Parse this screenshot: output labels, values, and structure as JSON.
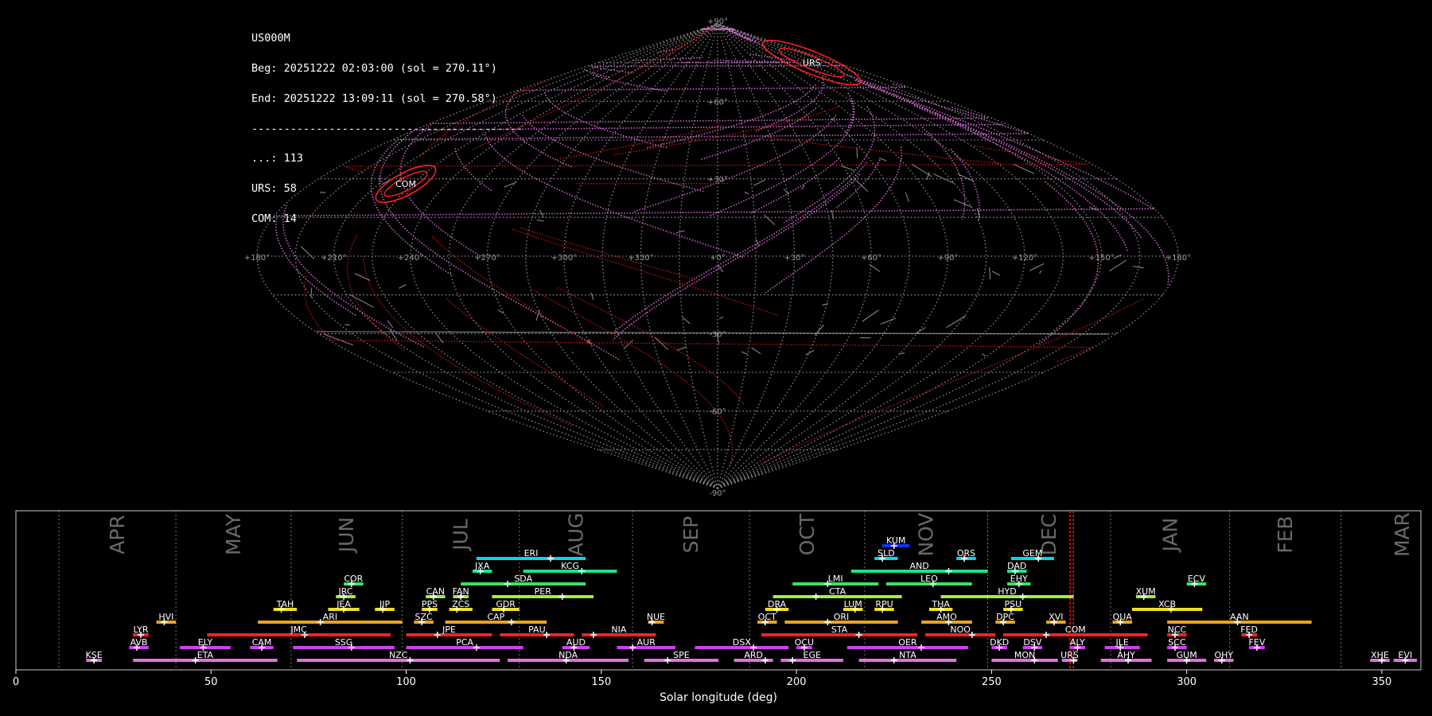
{
  "info": {
    "station": "US000M",
    "beg": "Beg: 20251222 02:03:00 (sol = 270.11°)",
    "end": "End: 20251222 13:09:11 (sol = 270.58°)",
    "separator": "------------------------------------------",
    "counts": [
      {
        "label": "...",
        "count": 113
      },
      {
        "label": "URS",
        "count": 58
      },
      {
        "label": "COM",
        "count": 14
      }
    ]
  },
  "sky_map": {
    "projection": "sinusoidal",
    "lon_labels": [
      "+180°",
      "+150°",
      "+120°",
      "+90°",
      "+60°",
      "+30°",
      "+0°",
      "+330°",
      "+300°",
      "+270°",
      "+240°",
      "+210°",
      "+180°"
    ],
    "lat_labels": [
      "+90°",
      "+60°",
      "+30°",
      "-30°",
      "-60°",
      "-90°"
    ],
    "radiants": [
      {
        "code": "URS",
        "lon_deg": 218,
        "lat_deg": 75,
        "color": "#ff2020"
      },
      {
        "code": "COM",
        "lon_deg": 138,
        "lat_deg": 28,
        "color": "#ff2020"
      }
    ],
    "track_color": "#e070e0",
    "sporadic_color": "#b0b0b0"
  },
  "chart_data": {
    "type": "timeline",
    "xlabel": "Solar longitude (deg)",
    "xlim": [
      0,
      360
    ],
    "xticks": [
      0,
      50,
      100,
      150,
      200,
      250,
      300,
      350
    ],
    "current_sol": [
      270.11,
      270.58
    ],
    "months": [
      {
        "name": "APR",
        "start": 11,
        "end": 41
      },
      {
        "name": "MAY",
        "start": 41,
        "end": 70.5
      },
      {
        "name": "JUN",
        "start": 70.5,
        "end": 99
      },
      {
        "name": "JUL",
        "start": 99,
        "end": 129
      },
      {
        "name": "AUG",
        "start": 129,
        "end": 158
      },
      {
        "name": "SEP",
        "start": 158,
        "end": 188
      },
      {
        "name": "OCT",
        "start": 188,
        "end": 217.5
      },
      {
        "name": "NOV",
        "start": 217.5,
        "end": 249
      },
      {
        "name": "DEC",
        "start": 249,
        "end": 280.5
      },
      {
        "name": "JAN",
        "start": 280.5,
        "end": 311
      },
      {
        "name": "FEB",
        "start": 311,
        "end": 339.5
      },
      {
        "name": "MAR",
        "start": 339.5,
        "end": 371
      }
    ],
    "showers": [
      {
        "code": "KUM",
        "row": 0,
        "start": 222,
        "end": 229,
        "peak": 225,
        "color": "#1a2eff"
      },
      {
        "code": "ERI",
        "row": 1,
        "start": 118,
        "end": 146,
        "peak": 137,
        "color": "#00d8f0"
      },
      {
        "code": "SLD",
        "row": 1,
        "start": 220,
        "end": 226,
        "peak": 222,
        "color": "#00d8f0"
      },
      {
        "code": "ORS",
        "row": 1,
        "start": 241,
        "end": 246,
        "peak": 243,
        "color": "#00d8f0"
      },
      {
        "code": "GEM",
        "row": 1,
        "start": 255,
        "end": 266,
        "peak": 262,
        "color": "#00d8f0"
      },
      {
        "code": "JXA",
        "row": 2,
        "start": 117,
        "end": 122,
        "peak": 119,
        "color": "#20e090"
      },
      {
        "code": "KCG",
        "row": 2,
        "start": 130,
        "end": 154,
        "peak": 145,
        "color": "#20e090"
      },
      {
        "code": "AND",
        "row": 2,
        "start": 214,
        "end": 249,
        "peak": 239,
        "color": "#20e090"
      },
      {
        "code": "DAD",
        "row": 2,
        "start": 254,
        "end": 259,
        "peak": 256,
        "color": "#20e090"
      },
      {
        "code": "COR",
        "row": 3,
        "start": 84,
        "end": 89,
        "peak": 86,
        "color": "#40e060"
      },
      {
        "code": "SDA",
        "row": 3,
        "start": 114,
        "end": 146,
        "peak": 126,
        "color": "#40e060"
      },
      {
        "code": "LMI",
        "row": 3,
        "start": 199,
        "end": 221,
        "peak": 208,
        "color": "#40e060"
      },
      {
        "code": "LEO",
        "row": 3,
        "start": 223,
        "end": 245,
        "peak": 235,
        "color": "#40e060"
      },
      {
        "code": "EHY",
        "row": 3,
        "start": 254,
        "end": 260,
        "peak": 257,
        "color": "#40e060"
      },
      {
        "code": "ECV",
        "row": 3,
        "start": 300,
        "end": 305,
        "peak": 302,
        "color": "#40e060"
      },
      {
        "code": "JRC",
        "row": 4,
        "start": 82,
        "end": 87,
        "peak": 84,
        "color": "#a0f040"
      },
      {
        "code": "CAN",
        "row": 4,
        "start": 105,
        "end": 110,
        "peak": 107,
        "color": "#a0f040"
      },
      {
        "code": "FAN",
        "row": 4,
        "start": 112,
        "end": 116,
        "peak": 114,
        "color": "#a0f040"
      },
      {
        "code": "PER",
        "row": 4,
        "start": 122,
        "end": 148,
        "peak": 140,
        "color": "#a0f040"
      },
      {
        "code": "CTA",
        "row": 4,
        "start": 194,
        "end": 227,
        "peak": 205,
        "color": "#a0f040"
      },
      {
        "code": "HYD",
        "row": 4,
        "start": 237,
        "end": 271,
        "peak": 258,
        "color": "#a0f040"
      },
      {
        "code": "XUM",
        "row": 4,
        "start": 287,
        "end": 292,
        "peak": 289,
        "color": "#a0f040"
      },
      {
        "code": "TAH",
        "row": 5,
        "start": 66,
        "end": 72,
        "peak": 68,
        "color": "#f0e020"
      },
      {
        "code": "JEA",
        "row": 5,
        "start": 80,
        "end": 88,
        "peak": 84,
        "color": "#f0e020"
      },
      {
        "code": "JIP",
        "row": 5,
        "start": 92,
        "end": 97,
        "peak": 94,
        "color": "#f0e020"
      },
      {
        "code": "PPS",
        "row": 5,
        "start": 104,
        "end": 108,
        "peak": 106,
        "color": "#f0e020"
      },
      {
        "code": "ZCS",
        "row": 5,
        "start": 111,
        "end": 117,
        "peak": 113,
        "color": "#f0e020"
      },
      {
        "code": "GDR",
        "row": 5,
        "start": 122,
        "end": 129,
        "peak": 125,
        "color": "#f0e020"
      },
      {
        "code": "DRA",
        "row": 5,
        "start": 192,
        "end": 198,
        "peak": 195,
        "color": "#f0e020"
      },
      {
        "code": "LUM",
        "row": 5,
        "start": 212,
        "end": 217,
        "peak": 215,
        "color": "#f0e020"
      },
      {
        "code": "RPU",
        "row": 5,
        "start": 220,
        "end": 225,
        "peak": 222,
        "color": "#f0e020"
      },
      {
        "code": "THA",
        "row": 5,
        "start": 234,
        "end": 240,
        "peak": 237,
        "color": "#f0e020"
      },
      {
        "code": "PSU",
        "row": 5,
        "start": 253,
        "end": 258,
        "peak": 255,
        "color": "#f0e020"
      },
      {
        "code": "XCB",
        "row": 5,
        "start": 286,
        "end": 304,
        "peak": 296,
        "color": "#f0e020"
      },
      {
        "code": "HVI",
        "row": 6,
        "start": 36,
        "end": 41,
        "peak": 38,
        "color": "#f0a020"
      },
      {
        "code": "ARI",
        "row": 6,
        "start": 62,
        "end": 99,
        "peak": 78,
        "color": "#f0a020"
      },
      {
        "code": "SZC",
        "row": 6,
        "start": 102,
        "end": 107,
        "peak": 104,
        "color": "#f0a020"
      },
      {
        "code": "CAP",
        "row": 6,
        "start": 110,
        "end": 136,
        "peak": 127,
        "color": "#f0a020"
      },
      {
        "code": "NUE",
        "row": 6,
        "start": 162,
        "end": 166,
        "peak": 163,
        "color": "#f0a020"
      },
      {
        "code": "OCT",
        "row": 6,
        "start": 190,
        "end": 195,
        "peak": 192,
        "color": "#f0a020"
      },
      {
        "code": "ORI",
        "row": 6,
        "start": 197,
        "end": 226,
        "peak": 208,
        "color": "#f0a020"
      },
      {
        "code": "AMO",
        "row": 6,
        "start": 232,
        "end": 245,
        "peak": 239,
        "color": "#f0a020"
      },
      {
        "code": "DPC",
        "row": 6,
        "start": 251,
        "end": 256,
        "peak": 253,
        "color": "#f0a020"
      },
      {
        "code": "XVI",
        "row": 6,
        "start": 264,
        "end": 269,
        "peak": 266,
        "color": "#f0a020"
      },
      {
        "code": "QUA",
        "row": 6,
        "start": 281,
        "end": 286,
        "peak": 283,
        "color": "#f0a020"
      },
      {
        "code": "AAN",
        "row": 6,
        "start": 295,
        "end": 332,
        "peak": 313,
        "color": "#f0a020"
      },
      {
        "code": "LYR",
        "row": 7,
        "start": 30,
        "end": 34,
        "peak": 32,
        "color": "#ff2020"
      },
      {
        "code": "JMC",
        "row": 7,
        "start": 49,
        "end": 96,
        "peak": 74,
        "color": "#ff2020"
      },
      {
        "code": "JPE",
        "row": 7,
        "start": 100,
        "end": 122,
        "peak": 108,
        "color": "#ff2020"
      },
      {
        "code": "PAU",
        "row": 7,
        "start": 124,
        "end": 143,
        "peak": 136,
        "color": "#ff2020"
      },
      {
        "code": "NIA",
        "row": 7,
        "start": 145,
        "end": 164,
        "peak": 148,
        "color": "#ff2020"
      },
      {
        "code": "STA",
        "row": 7,
        "start": 191,
        "end": 231,
        "peak": 216,
        "color": "#ff2020"
      },
      {
        "code": "NOO",
        "row": 7,
        "start": 233,
        "end": 251,
        "peak": 245,
        "color": "#ff2020"
      },
      {
        "code": "COM",
        "row": 7,
        "start": 253,
        "end": 290,
        "peak": 264,
        "color": "#ff2020"
      },
      {
        "code": "NCC",
        "row": 7,
        "start": 295,
        "end": 300,
        "peak": 297,
        "color": "#ff2020"
      },
      {
        "code": "FED",
        "row": 7,
        "start": 314,
        "end": 318,
        "peak": 316,
        "color": "#ff2020"
      },
      {
        "code": "AVB",
        "row": 8,
        "start": 29,
        "end": 34,
        "peak": 31,
        "color": "#d040f0"
      },
      {
        "code": "ELY",
        "row": 8,
        "start": 42,
        "end": 55,
        "peak": 48,
        "color": "#d040f0"
      },
      {
        "code": "CAM",
        "row": 8,
        "start": 60,
        "end": 66,
        "peak": 63,
        "color": "#d040f0"
      },
      {
        "code": "SSG",
        "row": 8,
        "start": 71,
        "end": 97,
        "peak": 86,
        "color": "#d040f0"
      },
      {
        "code": "PCA",
        "row": 8,
        "start": 100,
        "end": 130,
        "peak": 118,
        "color": "#d040f0"
      },
      {
        "code": "AUD",
        "row": 8,
        "start": 140,
        "end": 147,
        "peak": 143,
        "color": "#d040f0"
      },
      {
        "code": "AUR",
        "row": 8,
        "start": 154,
        "end": 169,
        "peak": 158,
        "color": "#d040f0"
      },
      {
        "code": "DSX",
        "row": 8,
        "start": 174,
        "end": 198,
        "peak": 189,
        "color": "#d040f0"
      },
      {
        "code": "OCU",
        "row": 8,
        "start": 200,
        "end": 204,
        "peak": 202,
        "color": "#d040f0"
      },
      {
        "code": "OER",
        "row": 8,
        "start": 213,
        "end": 244,
        "peak": 232,
        "color": "#d040f0"
      },
      {
        "code": "DKD",
        "row": 8,
        "start": 250,
        "end": 254,
        "peak": 252,
        "color": "#d040f0"
      },
      {
        "code": "DSV",
        "row": 8,
        "start": 258,
        "end": 263,
        "peak": 261,
        "color": "#d040f0"
      },
      {
        "code": "ALY",
        "row": 8,
        "start": 270,
        "end": 274,
        "peak": 272,
        "color": "#d040f0"
      },
      {
        "code": "JLE",
        "row": 8,
        "start": 279,
        "end": 288,
        "peak": 283,
        "color": "#d040f0"
      },
      {
        "code": "SCC",
        "row": 8,
        "start": 295,
        "end": 300,
        "peak": 297,
        "color": "#d040f0"
      },
      {
        "code": "FEV",
        "row": 8,
        "start": 316,
        "end": 320,
        "peak": 318,
        "color": "#d040f0"
      },
      {
        "code": "KSE",
        "row": 9,
        "start": 18,
        "end": 22,
        "peak": 20,
        "color": "#e070e0"
      },
      {
        "code": "ETA",
        "row": 9,
        "start": 30,
        "end": 67,
        "peak": 46,
        "color": "#e070e0"
      },
      {
        "code": "NZC",
        "row": 9,
        "start": 72,
        "end": 124,
        "peak": 101,
        "color": "#e070e0"
      },
      {
        "code": "NDA",
        "row": 9,
        "start": 126,
        "end": 157,
        "peak": 141,
        "color": "#e070e0"
      },
      {
        "code": "SPE",
        "row": 9,
        "start": 161,
        "end": 180,
        "peak": 167,
        "color": "#e070e0"
      },
      {
        "code": "ARD",
        "row": 9,
        "start": 184,
        "end": 194,
        "peak": 192,
        "color": "#e070e0"
      },
      {
        "code": "EGE",
        "row": 9,
        "start": 196,
        "end": 212,
        "peak": 199,
        "color": "#e070e0"
      },
      {
        "code": "NTA",
        "row": 9,
        "start": 216,
        "end": 241,
        "peak": 225,
        "color": "#e070e0"
      },
      {
        "code": "MON",
        "row": 9,
        "start": 250,
        "end": 267,
        "peak": 261,
        "color": "#e070e0"
      },
      {
        "code": "URS",
        "row": 9,
        "start": 268,
        "end": 272,
        "peak": 271,
        "color": "#e070e0"
      },
      {
        "code": "AHY",
        "row": 9,
        "start": 278,
        "end": 291,
        "peak": 285,
        "color": "#e070e0"
      },
      {
        "code": "GUM",
        "row": 9,
        "start": 295,
        "end": 305,
        "peak": 300,
        "color": "#e070e0"
      },
      {
        "code": "OHY",
        "row": 9,
        "start": 307,
        "end": 312,
        "peak": 309,
        "color": "#e070e0"
      },
      {
        "code": "XHE",
        "row": 9,
        "start": 347,
        "end": 352,
        "peak": 350,
        "color": "#e070e0"
      },
      {
        "code": "EVI",
        "row": 9,
        "start": 353,
        "end": 359,
        "peak": 356,
        "color": "#e070e0"
      }
    ]
  }
}
